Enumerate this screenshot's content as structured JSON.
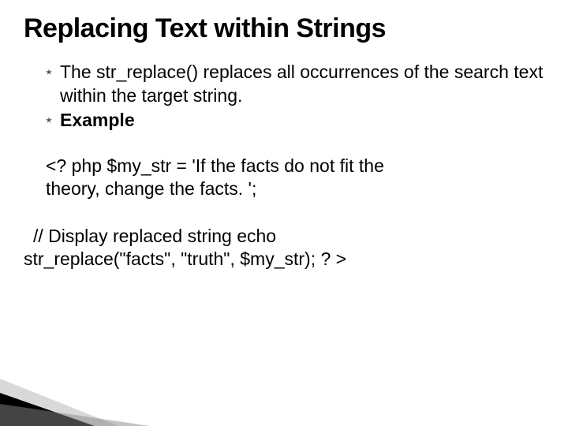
{
  "title": "Replacing Text within Strings",
  "bullets": [
    "The str_replace() replaces all occurrences of the search text within the target string.",
    "Example"
  ],
  "code": {
    "p1_l1": "<? php $my_str = 'If the facts do not fit the",
    "p1_l2": "theory, change the facts. ';",
    "p2_l1": "// Display replaced string echo",
    "p2_l2": "str_replace(\"facts\", \"truth\", $my_str); ? >"
  }
}
